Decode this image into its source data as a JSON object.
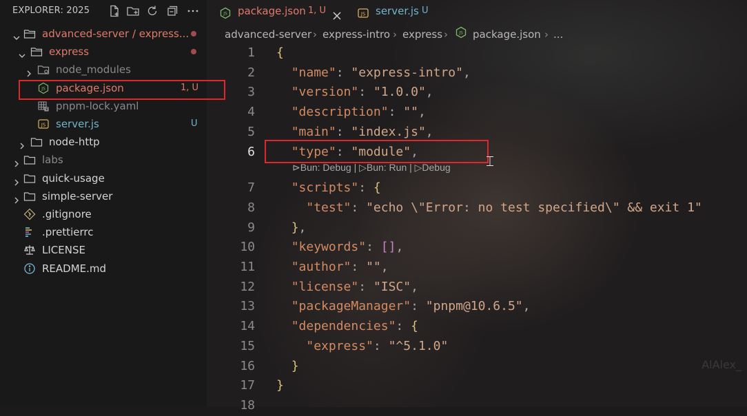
{
  "explorer": {
    "title": "EXPLORER: 2025",
    "actions": [
      "new-file-icon",
      "new-folder-icon",
      "refresh-icon",
      "collapse-icon",
      "more-icon"
    ]
  },
  "tree": [
    {
      "label": "advanced-server / express...",
      "indent": 0,
      "type": "folder-open",
      "expanded": true,
      "color": "#e07a6a",
      "dot": true
    },
    {
      "label": "express",
      "indent": 1,
      "type": "folder-open",
      "expanded": true,
      "color": "#e07a6a",
      "dot": true
    },
    {
      "label": "node_modules",
      "indent": 2,
      "type": "folder-special",
      "expanded": false,
      "color": "#8a8a8a"
    },
    {
      "label": "package.json",
      "indent": 2,
      "type": "json",
      "color": "#e07a6a",
      "badge": "1, U",
      "selected": true
    },
    {
      "label": "pnpm-lock.yaml",
      "indent": 2,
      "type": "yaml",
      "color": "#8a8a8a"
    },
    {
      "label": "server.js",
      "indent": 2,
      "type": "js",
      "color": "#6fb7c9",
      "badge": "U"
    },
    {
      "label": "node-http",
      "indent": 1,
      "type": "folder",
      "expanded": false,
      "color": "#d4d4d4"
    },
    {
      "label": "labs",
      "indent": 0,
      "type": "folder",
      "expanded": false,
      "color": "#8a8a8a"
    },
    {
      "label": "quick-usage",
      "indent": 0,
      "type": "folder",
      "expanded": false,
      "color": "#d4d4d4"
    },
    {
      "label": "simple-server",
      "indent": 0,
      "type": "folder",
      "expanded": false,
      "color": "#d4d4d4"
    },
    {
      "label": ".gitignore",
      "indent": 0,
      "type": "git",
      "color": "#d4d4d4"
    },
    {
      "label": ".prettierrc",
      "indent": 0,
      "type": "prettier",
      "color": "#d4d4d4"
    },
    {
      "label": "LICENSE",
      "indent": 0,
      "type": "license",
      "color": "#d4d4d4"
    },
    {
      "label": "README.md",
      "indent": 0,
      "type": "info",
      "color": "#d4d4d4"
    }
  ],
  "tabs": [
    {
      "label": "package.json",
      "status": "1, U",
      "active": true,
      "color": "#e07a6a"
    },
    {
      "label": "server.js",
      "status": "U",
      "active": false,
      "color": "#6fb7c9"
    }
  ],
  "breadcrumb": [
    "advanced-server",
    "express-intro",
    "express",
    "package.json",
    "..."
  ],
  "editor": {
    "active_line": 6,
    "codelens": "Bun: Debug | ▷Bun: Run | ▷Debug",
    "lines": [
      {
        "n": "1",
        "text": "{"
      },
      {
        "n": "2",
        "text": "  \"name\": \"express-intro\","
      },
      {
        "n": "3",
        "text": "  \"version\": \"1.0.0\","
      },
      {
        "n": "4",
        "text": "  \"description\": \"\","
      },
      {
        "n": "5",
        "text": "  \"main\": \"index.js\","
      },
      {
        "n": "6",
        "text": "  \"type\": \"module\","
      },
      {
        "n": "7",
        "text": "  \"scripts\": {"
      },
      {
        "n": "8",
        "text": "    \"test\": \"echo \\\"Error: no test specified\\\" && exit 1\""
      },
      {
        "n": "9",
        "text": "  },"
      },
      {
        "n": "10",
        "text": "  \"keywords\": [],"
      },
      {
        "n": "11",
        "text": "  \"author\": \"\","
      },
      {
        "n": "12",
        "text": "  \"license\": \"ISC\","
      },
      {
        "n": "13",
        "text": "  \"packageManager\": \"pnpm@10.6.5\","
      },
      {
        "n": "14",
        "text": "  \"dependencies\": {"
      },
      {
        "n": "15",
        "text": "    \"express\": \"^5.1.0\""
      },
      {
        "n": "16",
        "text": "  }"
      },
      {
        "n": "17",
        "text": "}"
      },
      {
        "n": "18",
        "text": ""
      }
    ]
  },
  "watermark": "AlAlex_"
}
